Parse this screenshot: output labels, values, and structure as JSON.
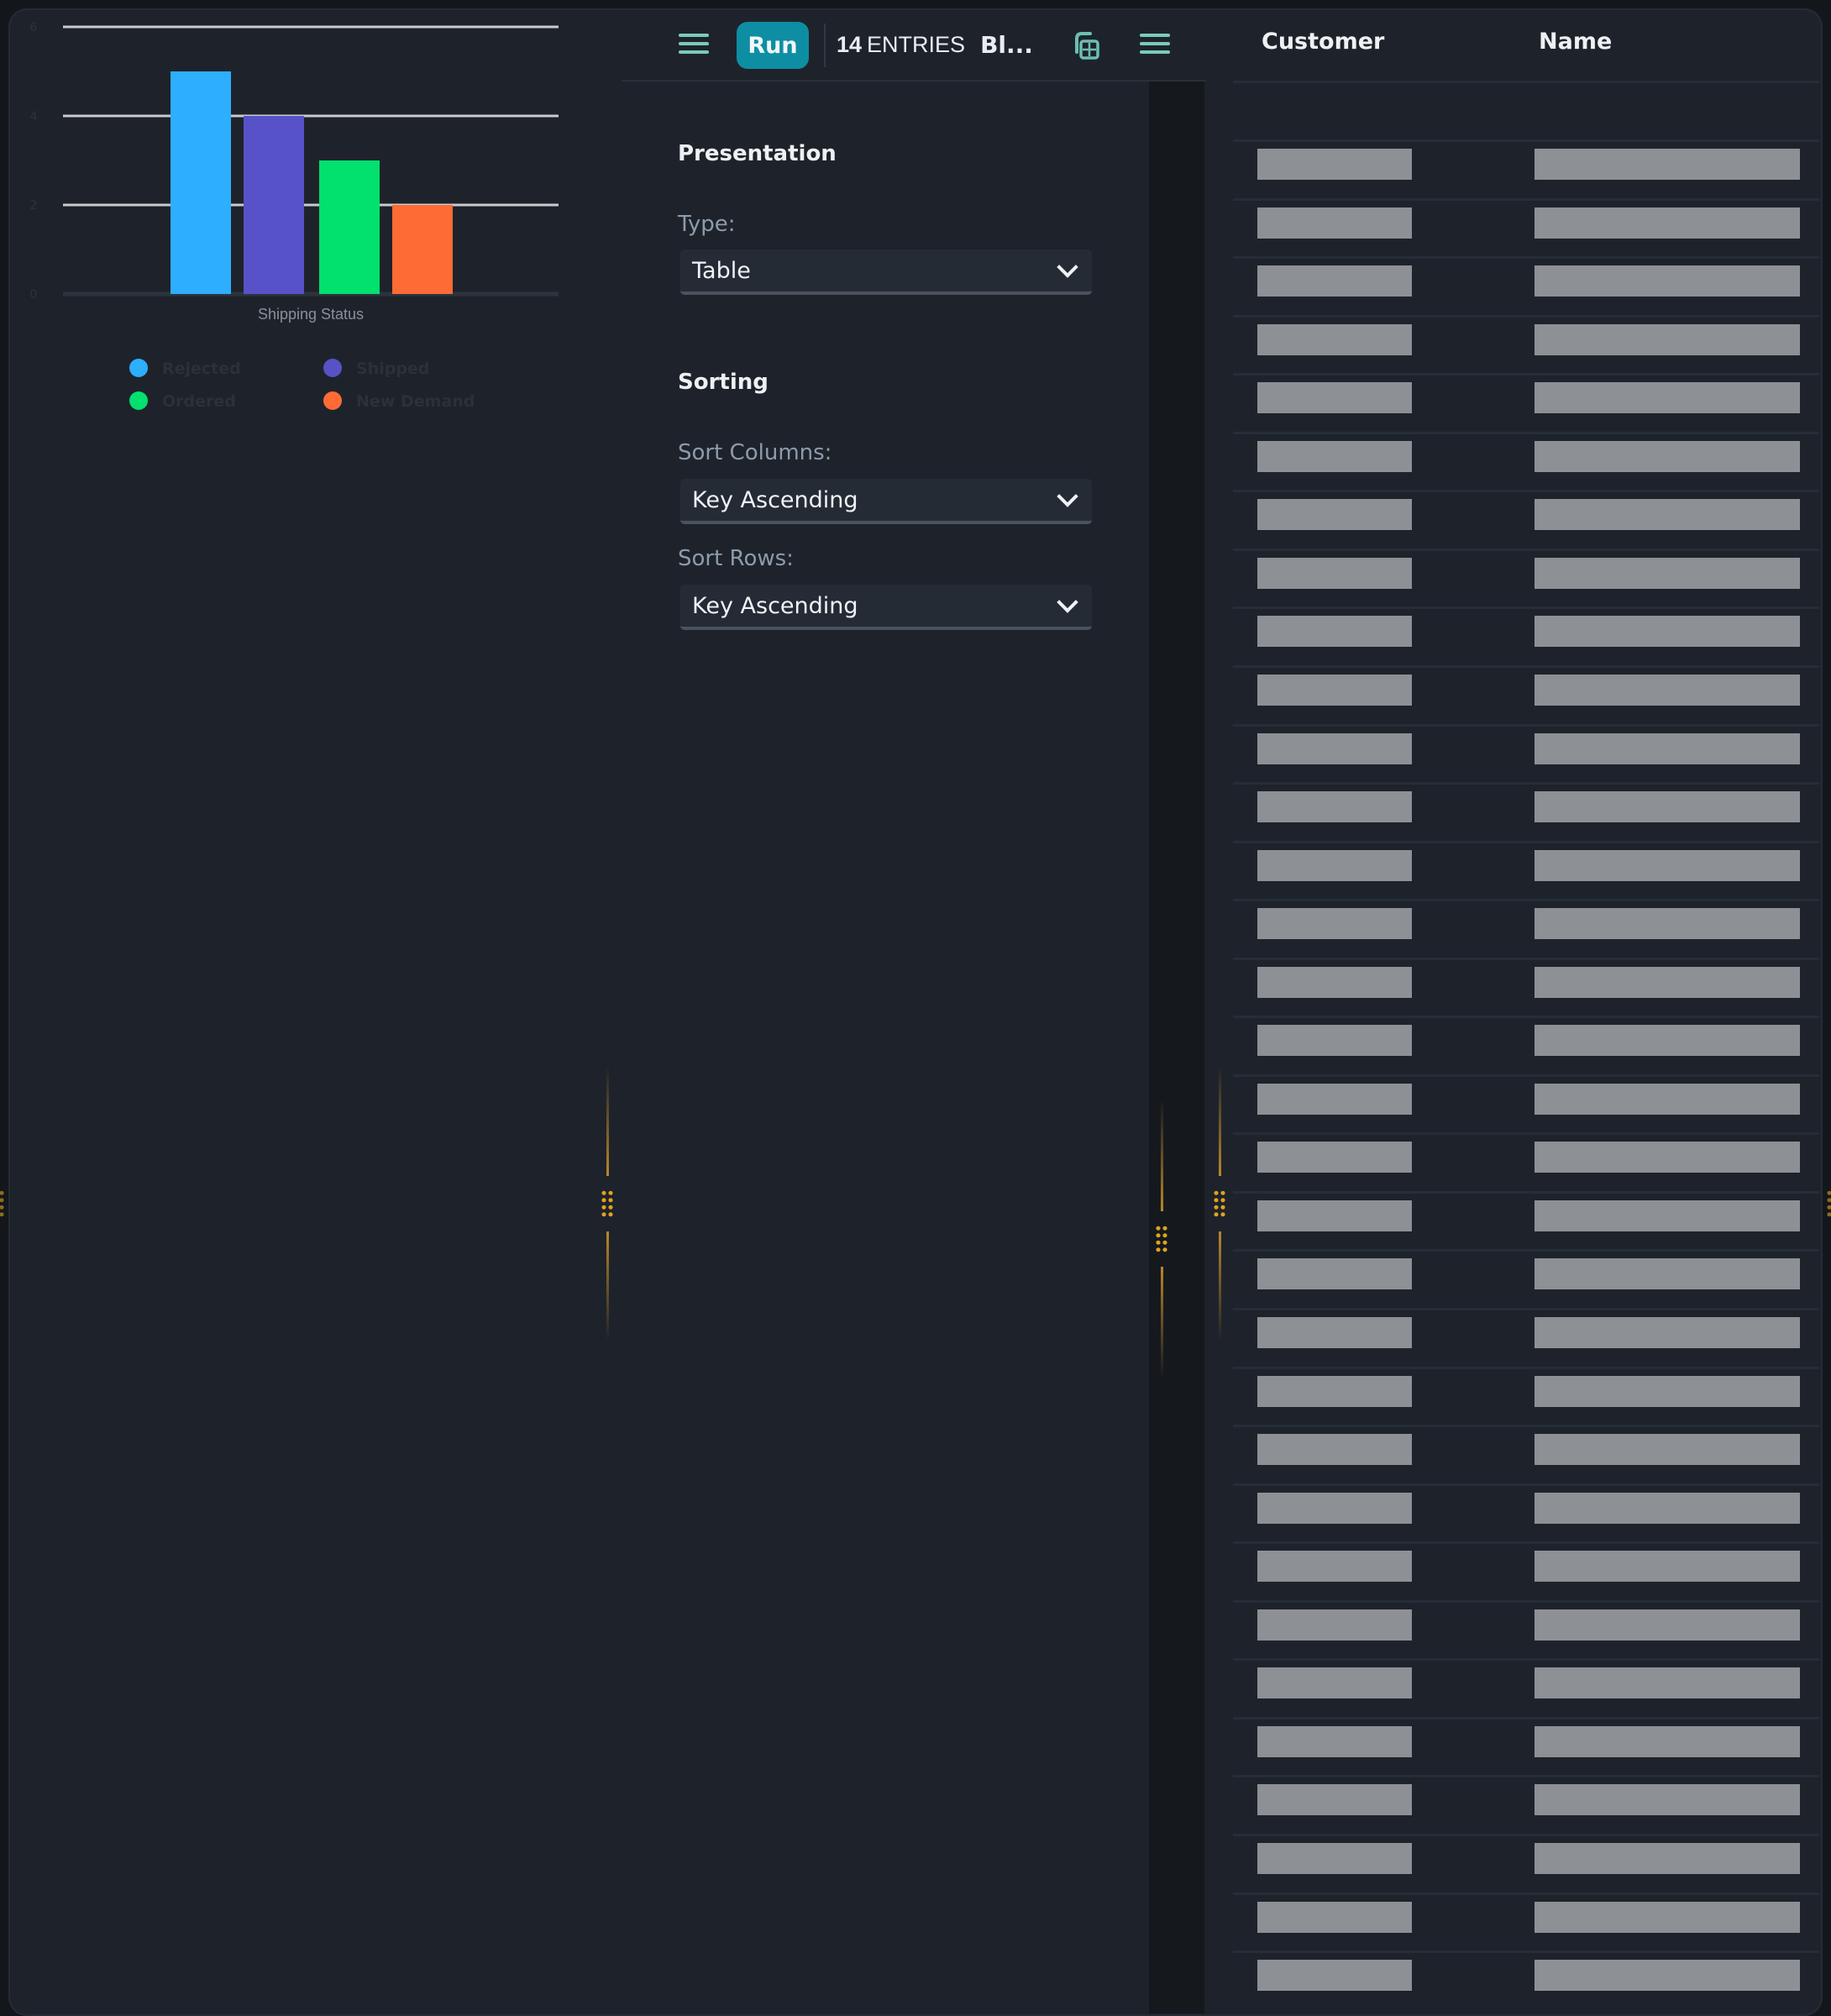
{
  "chart_data": {
    "type": "bar",
    "title": "",
    "xlabel": "Shipping Status",
    "ylabel": "",
    "ylim": [
      0,
      6
    ],
    "yticks": [
      0,
      2,
      4,
      6
    ],
    "grid": true,
    "legend_position": "bottom",
    "categories": [
      "Shipping Status"
    ],
    "series": [
      {
        "name": "Rejected",
        "values": [
          5
        ],
        "color": "#2daefe"
      },
      {
        "name": "Shipped",
        "values": [
          4
        ],
        "color": "#5852c8"
      },
      {
        "name": "Ordered",
        "values": [
          3
        ],
        "color": "#02e06e"
      },
      {
        "name": "New Demand",
        "values": [
          2
        ],
        "color": "#fe6b35"
      }
    ]
  },
  "toolbar": {
    "run_label": "Run",
    "entries_count": "14",
    "entries_label": "ENTRIES",
    "title_truncated": "Bl...",
    "icons": [
      "menu-icon",
      "table-copy-icon",
      "menu-icon"
    ]
  },
  "presentation": {
    "title": "Presentation",
    "type_label": "Type:",
    "type_value": "Table"
  },
  "sorting": {
    "title": "Sorting",
    "sort_columns_label": "Sort Columns:",
    "sort_columns_value": "Key Ascending",
    "sort_rows_label": "Sort Rows:",
    "sort_rows_value": "Key Ascending"
  },
  "table": {
    "columns": [
      "Customer",
      "Name"
    ],
    "rows_visible": 32,
    "rows_state": "loading-placeholder"
  },
  "colors": {
    "accent": "#0e8ea3",
    "icon_teal": "#7bcbb9",
    "grip": "#e0a31e",
    "panel_bg": "#1e232b"
  }
}
